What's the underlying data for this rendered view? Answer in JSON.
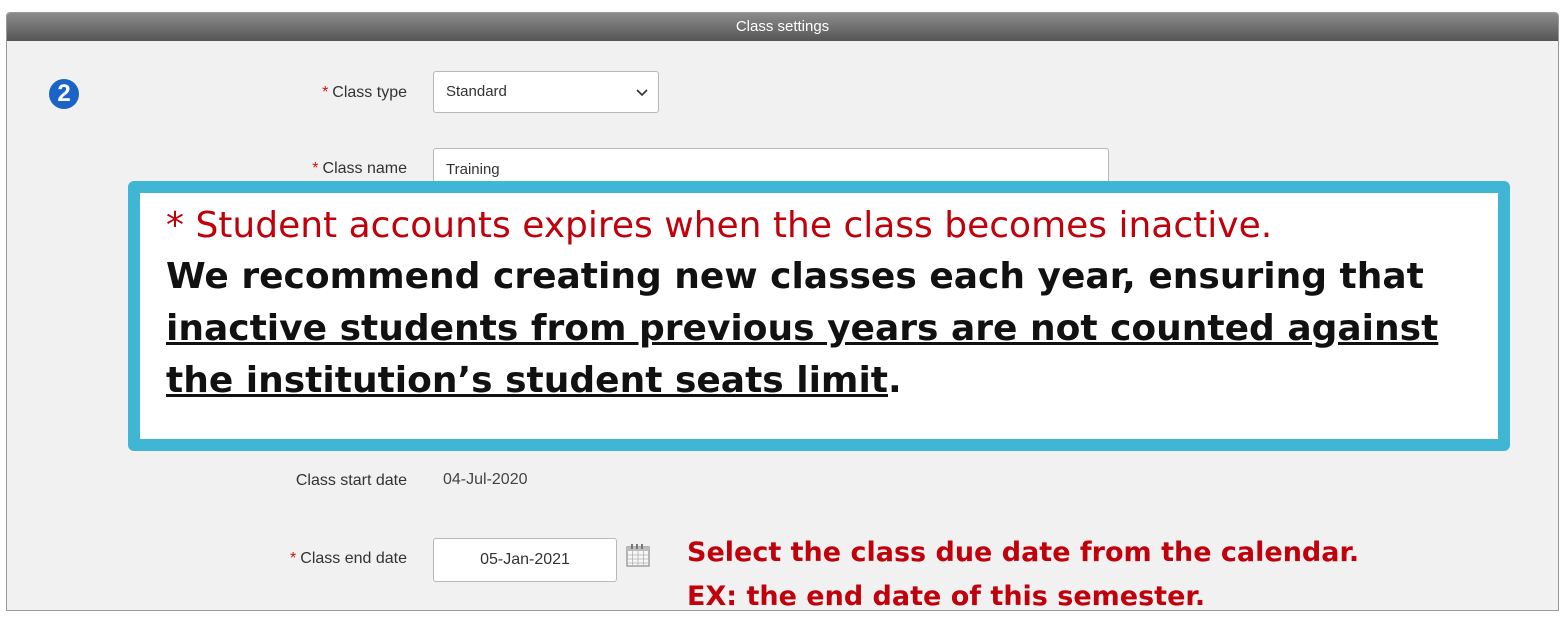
{
  "header": {
    "title": "Class settings"
  },
  "step": {
    "number": "2"
  },
  "form": {
    "required_marker": "*",
    "class_type": {
      "label": "Class type",
      "value": "Standard"
    },
    "class_name": {
      "label": "Class name",
      "value": "Training"
    },
    "class_start_date": {
      "label": "Class start date",
      "value": "04-Jul-2020"
    },
    "class_end_date": {
      "label": "Class end date",
      "value": "05-Jan-2021"
    }
  },
  "callout": {
    "line1": "* Student accounts expires when the class becomes inactive.",
    "line2_prefix": "We recommend creating new classes each year, ensuring that ",
    "line2_underlined": "inactive students from previous years are not counted against the institution’s student seats limit",
    "line2_suffix": "."
  },
  "note": {
    "line1": "Select the class due date from the calendar.",
    "line2": "EX: the end date of this semester."
  },
  "icons": {
    "dropdown": "chevron-down-icon",
    "calendar": "calendar-icon"
  },
  "colors": {
    "accent": "#3fb6d4",
    "warning_text": "#c0000b",
    "step_badge": "#1a63c7"
  }
}
